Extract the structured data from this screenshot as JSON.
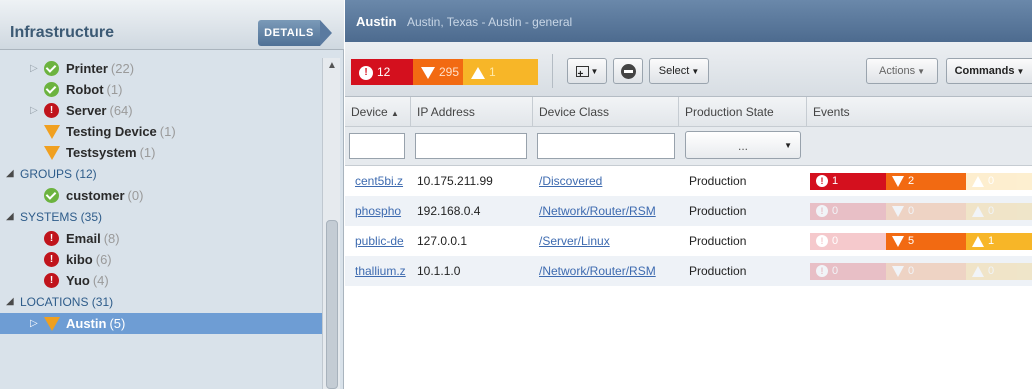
{
  "left_panel": {
    "title": "Infrastructure",
    "details_label": "DETAILS",
    "tree": [
      {
        "label": "Printer",
        "count": "(22)",
        "status": "ok",
        "expandable": true
      },
      {
        "label": "Robot",
        "count": "(1)",
        "status": "ok",
        "expandable": false
      },
      {
        "label": "Server",
        "count": "(64)",
        "status": "critical",
        "expandable": true
      },
      {
        "label": "Testing Device",
        "count": "(1)",
        "status": "warning",
        "expandable": false
      },
      {
        "label": "Testsystem",
        "count": "(1)",
        "status": "warning",
        "expandable": false
      }
    ],
    "groups": {
      "label": "GROUPS (12)",
      "items": [
        {
          "label": "customer",
          "count": "(0)",
          "status": "ok"
        }
      ]
    },
    "systems": {
      "label": "SYSTEMS (35)",
      "items": [
        {
          "label": "Email",
          "count": "(8)",
          "status": "critical"
        },
        {
          "label": "kibo",
          "count": "(6)",
          "status": "critical"
        },
        {
          "label": "Yuo",
          "count": "(4)",
          "status": "critical"
        }
      ]
    },
    "locations": {
      "label": "LOCATIONS (31)",
      "items": [
        {
          "label": "Austin",
          "count": "(5)",
          "status": "warning",
          "selected": true
        }
      ]
    }
  },
  "header": {
    "name": "Austin",
    "subtitle": "Austin, Texas - Austin - general"
  },
  "toolbar": {
    "severity": {
      "critical": "12",
      "error": "295",
      "warning": "1"
    },
    "select_label": "Select",
    "actions_label": "Actions",
    "commands_label": "Commands"
  },
  "grid": {
    "columns": [
      "Device",
      "IP Address",
      "Device Class",
      "Production State",
      "Events"
    ],
    "filter_placeholder": "...",
    "rows": [
      {
        "device": "cent5bi.z",
        "ip": "10.175.211.99",
        "class": "/Discovered",
        "state": "Production",
        "events": {
          "critical": "1",
          "error": "2",
          "warning": "0"
        }
      },
      {
        "device": "phospho",
        "ip": "192.168.0.4",
        "class": "/Network/Router/RSM",
        "state": "Production",
        "events": {
          "critical": "0",
          "error": "0",
          "warning": "0"
        }
      },
      {
        "device": "public-de",
        "ip": "127.0.0.1",
        "class": "/Server/Linux",
        "state": "Production",
        "events": {
          "critical": "0",
          "error": "5",
          "warning": "1"
        }
      },
      {
        "device": "thallium.z",
        "ip": "10.1.1.0",
        "class": "/Network/Router/RSM",
        "state": "Production",
        "events": {
          "critical": "0",
          "error": "0",
          "warning": "0"
        }
      }
    ]
  },
  "colors": {
    "critical": "#d4101e",
    "error": "#f26a12",
    "warning": "#f7b628",
    "ok": "#6cb33f",
    "link": "#3e6bb0"
  }
}
